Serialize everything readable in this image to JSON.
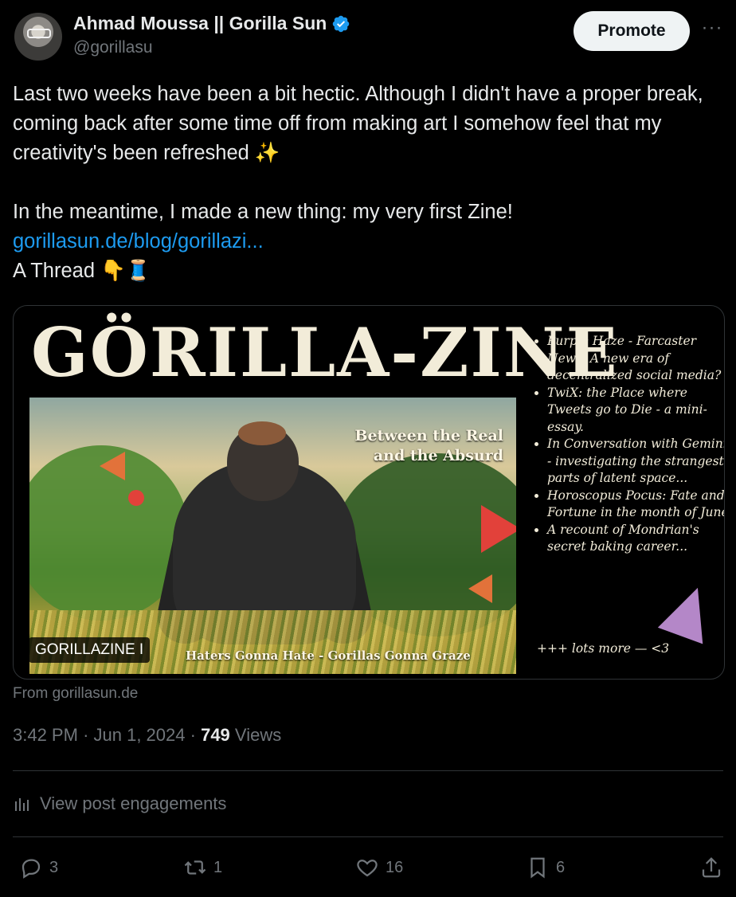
{
  "author": {
    "display_name": "Ahmad Moussa || Gorilla Sun",
    "handle": "@gorillasu",
    "verified": true
  },
  "header": {
    "promote_label": "Promote",
    "more_label": "···"
  },
  "post": {
    "paragraph1": "Last two weeks have been a bit hectic. Although I didn't have a proper break, coming back after some time off from making art I somehow feel that my creativity's been refreshed ✨",
    "paragraph2": "In the meantime, I made a new thing: my very first Zine!",
    "link": "gorillasun.de/blog/gorillazi...",
    "thread_line": "A Thread 👇🧵"
  },
  "card": {
    "title": "GÖRILLA-ZINE",
    "art_caption_line1": "Between the Real",
    "art_caption_line2": "and the Absurd",
    "art_footer": "Haters Gonna Hate - Gorillas Gonna Graze",
    "label": "GORILLAZINE I",
    "items": [
      "Purple Haze - Farcaster News. A new era of decentralized social media?",
      "TwiX: the Place where Tweets go to Die - a mini-essay.",
      "In Conversation with Gemini - investigating the strangest parts of latent space...",
      "Horoscopus Pocus: Fate and Fortune in the month of June.",
      "A recount of Mondrian's secret baking career..."
    ],
    "more": "+++ lots more — <3",
    "source": "From gorillasun.de"
  },
  "meta": {
    "time": "3:42 PM",
    "separator": "·",
    "date": "Jun 1, 2024",
    "views_count": "749",
    "views_label": "Views"
  },
  "engagements_label": "View post engagements",
  "actions": {
    "replies": "3",
    "reposts": "1",
    "likes": "16",
    "bookmarks": "6"
  },
  "colors": {
    "background": "#000000",
    "text": "#e7e9ea",
    "muted": "#71767b",
    "link": "#1d9bf0",
    "verified": "#1d9bf0",
    "border": "#2f3336"
  }
}
